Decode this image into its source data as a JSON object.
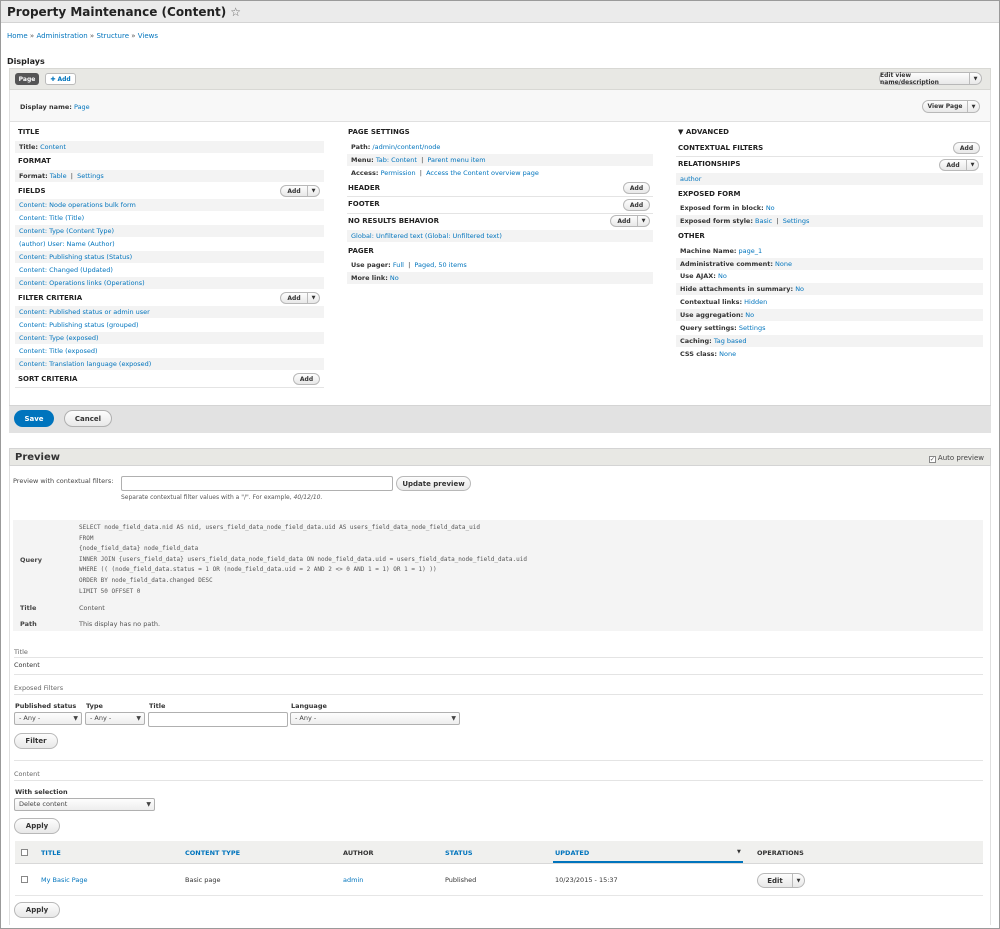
{
  "header": {
    "title": "Property Maintenance (Content)",
    "star_icon": "☆"
  },
  "breadcrumb": [
    "Home",
    "Administration",
    "Structure",
    "Views"
  ],
  "breadcrumb_sep": "»",
  "displays_label": "Displays",
  "tabs": {
    "page": "Page",
    "add": "Add"
  },
  "edit_view_btn": "Edit view name/description",
  "display_name_label": "Display name:",
  "display_name_value": "Page",
  "view_page_btn": "View Page",
  "add_label": "Add",
  "col1": {
    "title_h": "TITLE",
    "title_label": "Title:",
    "title_value": "Content",
    "format_h": "FORMAT",
    "format_label": "Format:",
    "format_value": "Table",
    "format_settings": "Settings",
    "fields_h": "FIELDS",
    "fields": [
      "Content: Node operations bulk form",
      "Content: Title (Title)",
      "Content: Type (Content Type)",
      "(author) User: Name (Author)",
      "Content: Publishing status (Status)",
      "Content: Changed (Updated)",
      "Content: Operations links (Operations)"
    ],
    "filter_h": "FILTER CRITERIA",
    "filters": [
      "Content: Published status or admin user",
      "Content: Publishing status (grouped)",
      "Content: Type (exposed)",
      "Content: Title (exposed)",
      "Content: Translation language (exposed)"
    ],
    "sort_h": "SORT CRITERIA"
  },
  "col2": {
    "page_settings_h": "PAGE SETTINGS",
    "path_label": "Path:",
    "path_value": "/admin/content/node",
    "menu_label": "Menu:",
    "menu_value": "Tab: Content",
    "menu_parent": "Parent menu item",
    "access_label": "Access:",
    "access_value": "Permission",
    "access_extra": "Access the Content overview page",
    "header_h": "HEADER",
    "footer_h": "FOOTER",
    "nores_h": "NO RESULTS BEHAVIOR",
    "nores_value": "Global: Unfiltered text (Global: Unfiltered text)",
    "pager_h": "PAGER",
    "use_pager_label": "Use pager:",
    "use_pager_value": "Full",
    "use_pager_items": "Paged, 50 items",
    "more_link_label": "More link:",
    "more_link_value": "No"
  },
  "col3": {
    "advanced_h": "▼ ADVANCED",
    "contextual_h": "CONTEXTUAL FILTERS",
    "relationships_h": "RELATIONSHIPS",
    "relationship_value": "author",
    "exposed_form_h": "EXPOSED FORM",
    "exposed_block_label": "Exposed form in block:",
    "exposed_block_value": "No",
    "exposed_style_label": "Exposed form style:",
    "exposed_style_value": "Basic",
    "exposed_style_settings": "Settings",
    "other_h": "OTHER",
    "other_rows": [
      {
        "label": "Machine Name:",
        "value": "page_1"
      },
      {
        "label": "Administrative comment:",
        "value": "None"
      },
      {
        "label": "Use AJAX:",
        "value": "No"
      },
      {
        "label": "Hide attachments in summary:",
        "value": "No"
      },
      {
        "label": "Contextual links:",
        "value": "Hidden"
      },
      {
        "label": "Use aggregation:",
        "value": "No"
      },
      {
        "label": "Query settings:",
        "value": "Settings"
      },
      {
        "label": "Caching:",
        "value": "Tag based"
      },
      {
        "label": "CSS class:",
        "value": "None"
      }
    ]
  },
  "save_btn": "Save",
  "cancel_btn": "Cancel",
  "preview": {
    "title": "Preview",
    "auto_preview": "Auto preview",
    "contextual_label": "Preview with contextual filters:",
    "update_btn": "Update preview",
    "help_text": "Separate contextual filter values with a \"/\". For example,",
    "help_example": "40/12/10.",
    "query_label": "Query",
    "query_lines": [
      "SELECT node_field_data.nid AS nid, users_field_data_node_field_data.uid AS users_field_data_node_field_data_uid",
      "FROM",
      "{node_field_data} node_field_data",
      "INNER JOIN {users_field_data} users_field_data_node_field_data ON node_field_data.uid = users_field_data_node_field_data.uid",
      "WHERE (( (node_field_data.status = 1 OR (node_field_data.uid = 2 AND 2 <> 0 AND 1 = 1) OR 1 = 1) ))",
      "ORDER BY node_field_data.changed DESC",
      "LIMIT 50 OFFSET 0"
    ],
    "title_label": "Title",
    "title_value": "Content",
    "path_label": "Path",
    "path_value": "This display has no path."
  },
  "result": {
    "title_h": "Title",
    "title_value": "Content",
    "exposed_h": "Exposed Filters",
    "f_status": "Published status",
    "f_type": "Type",
    "f_title": "Title",
    "f_language": "Language",
    "any": "- Any -",
    "filter_btn": "Filter",
    "content_h": "Content",
    "with_selection": "With selection",
    "bulk_action": "Delete content",
    "apply_btn": "Apply",
    "columns": [
      "TITLE",
      "CONTENT TYPE",
      "AUTHOR",
      "STATUS",
      "UPDATED",
      "OPERATIONS"
    ],
    "rows": [
      {
        "title": "My Basic Page",
        "type": "Basic page",
        "author": "admin",
        "status": "Published",
        "updated": "10/23/2015 - 15:37",
        "op": "Edit"
      }
    ]
  }
}
